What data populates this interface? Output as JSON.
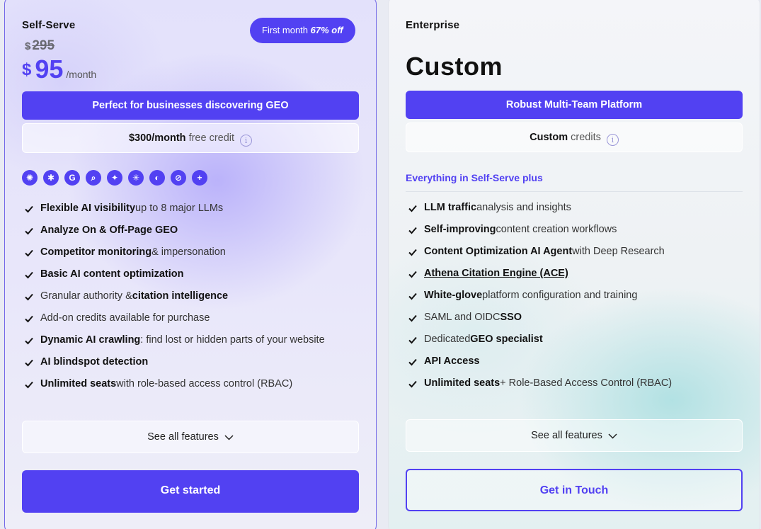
{
  "self_serve": {
    "name": "Self-Serve",
    "promo_prefix": "First month ",
    "promo_discount": "67% off",
    "old_currency": "$",
    "old_price": "295",
    "currency": "$",
    "price": "95",
    "period": "/month",
    "banner": "Perfect for businesses discovering GEO",
    "credit_amount": "$300/month",
    "credit_suffix": " free credit",
    "info_glyph": "i",
    "llm_icons": [
      {
        "name": "chatgpt-icon",
        "glyph": "✺"
      },
      {
        "name": "perplexity-icon",
        "glyph": "✱"
      },
      {
        "name": "google-icon",
        "glyph": "G"
      },
      {
        "name": "ai-search-icon",
        "glyph": "⌕"
      },
      {
        "name": "gemini-icon",
        "glyph": "✦"
      },
      {
        "name": "claude-icon",
        "glyph": "✳"
      },
      {
        "name": "copilot-icon",
        "glyph": "◐"
      },
      {
        "name": "grok-icon",
        "glyph": "⊘"
      },
      {
        "name": "more-llms-icon",
        "glyph": "+"
      }
    ],
    "features": [
      {
        "bold": "Flexible AI visibility",
        "rest": " up to 8 major LLMs"
      },
      {
        "bold": "Analyze On & Off-Page GEO",
        "rest": ""
      },
      {
        "bold": "Competitor monitoring",
        "rest": " & impersonation"
      },
      {
        "bold": "Basic AI content optimization",
        "rest": ""
      },
      {
        "pre": "Granular authority & ",
        "bold": "citation intelligence",
        "rest": ""
      },
      {
        "pre": "Add-on credits available for purchase",
        "bold": "",
        "rest": ""
      },
      {
        "bold": "Dynamic AI crawling",
        "rest": ": find lost or hidden parts of your website"
      },
      {
        "bold": "AI blindspot detection",
        "rest": ""
      },
      {
        "bold": "Unlimited seats",
        "rest": " with role-based access control (RBAC)"
      }
    ],
    "see_all": "See all features",
    "cta": "Get started"
  },
  "enterprise": {
    "name": "Enterprise",
    "price": "Custom",
    "banner": "Robust Multi-Team Platform",
    "credit_amount": "Custom",
    "credit_suffix": " credits",
    "info_glyph": "i",
    "plus_label": "Everything in Self-Serve plus",
    "features": [
      {
        "bold": "LLM traffic",
        "rest": " analysis and insights"
      },
      {
        "bold": "Self-improving",
        "rest": " content creation workflows"
      },
      {
        "bold": "Content Optimization AI Agent",
        "rest": " with Deep Research"
      },
      {
        "link": "Athena Citation Engine (ACE)",
        "bold": "",
        "rest": ""
      },
      {
        "bold": "White-glove",
        "rest": " platform configuration and training"
      },
      {
        "pre": "SAML and OIDC ",
        "bold": "SSO",
        "rest": ""
      },
      {
        "pre": "Dedicated ",
        "bold": "GEO specialist",
        "rest": ""
      },
      {
        "bold": "API Access",
        "rest": ""
      },
      {
        "bold": "Unlimited seats",
        "rest": " + Role-Based Access Control (RBAC)"
      }
    ],
    "see_all": "See all features",
    "cta": "Get in Touch"
  },
  "colors": {
    "accent": "#5241f2",
    "left_border": "#7166e8",
    "teal_glow": "#a0dcde"
  }
}
